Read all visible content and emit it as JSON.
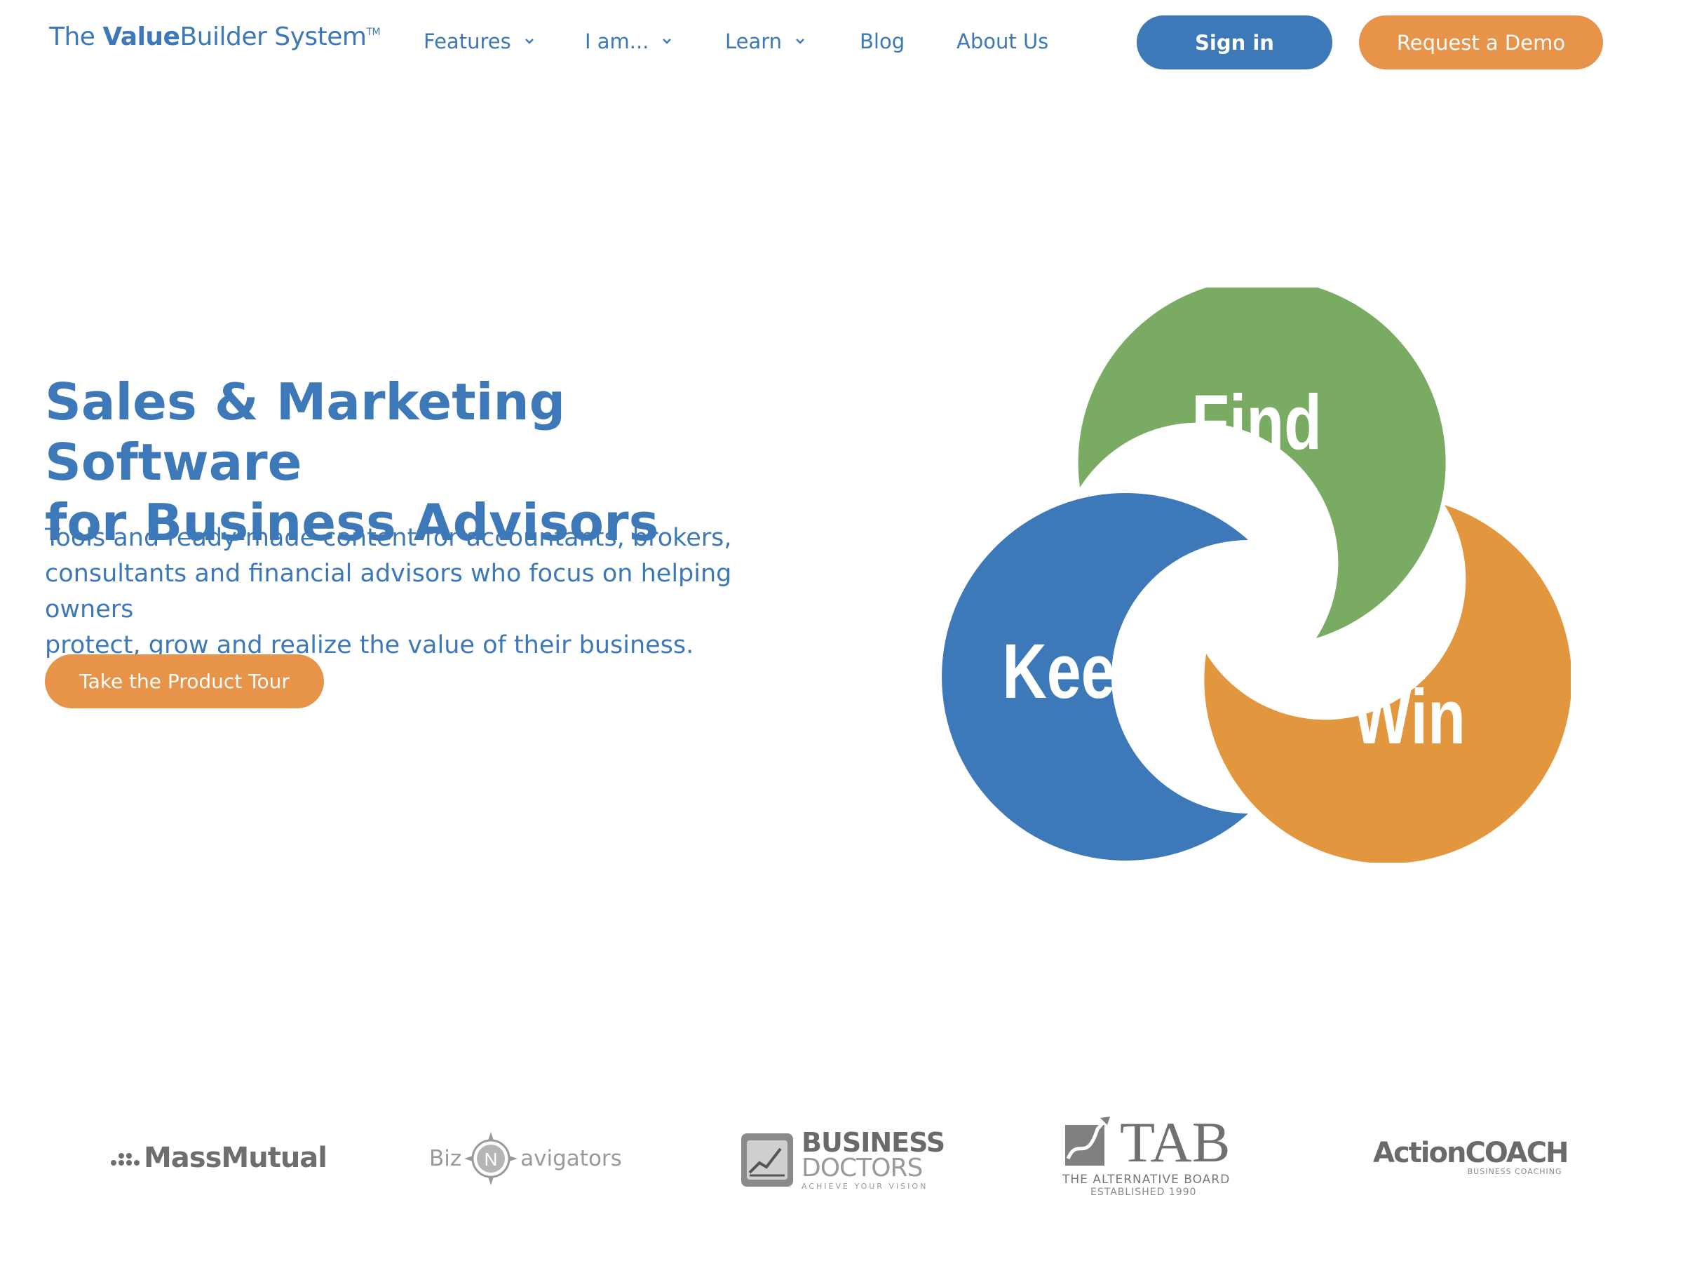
{
  "header": {
    "logo": {
      "prefix": "The ",
      "bold": "Value",
      "rest": "Builder System",
      "tm": "TM"
    },
    "nav": [
      {
        "label": "Features",
        "has_dropdown": true
      },
      {
        "label": "I am...",
        "has_dropdown": true
      },
      {
        "label": "Learn",
        "has_dropdown": true
      },
      {
        "label": "Blog",
        "has_dropdown": false
      },
      {
        "label": "About Us",
        "has_dropdown": false
      }
    ],
    "sign_in_label": "Sign in",
    "demo_label": "Request a Demo"
  },
  "hero": {
    "title_line1": "Sales & Marketing Software",
    "title_line2": "for Business Advisors",
    "subtitle_line1": "Tools and ready-made content for accountants, brokers,",
    "subtitle_line2": "consultants and financial advisors who focus on helping owners",
    "subtitle_line3": "protect, grow and realize the value of their business.",
    "cta_label": "Take the Product Tour"
  },
  "diagram": {
    "segments": [
      {
        "label": "Find",
        "color": "#7aab63"
      },
      {
        "label": "Keep",
        "color": "#3d78b8"
      },
      {
        "label": "Win",
        "color": "#e2973f"
      }
    ]
  },
  "partners": {
    "massmutual": "MassMutual",
    "biznavigators": {
      "left": "Biz",
      "letter": "N",
      "right": "avigators"
    },
    "business_doctors": {
      "line1": "BUSINESS",
      "line2": "DOCTORS",
      "tagline": "ACHIEVE YOUR VISION"
    },
    "tab": {
      "name": "TAB",
      "line1": "THE ALTERNATIVE BOARD",
      "line2": "ESTABLISHED 1990"
    },
    "actioncoach": {
      "name": "ActionCOACH",
      "tagline": "BUSINESS COACHING"
    }
  },
  "colors": {
    "primary": "#3d78b8",
    "accent": "#e8934a",
    "green": "#7aab63"
  }
}
